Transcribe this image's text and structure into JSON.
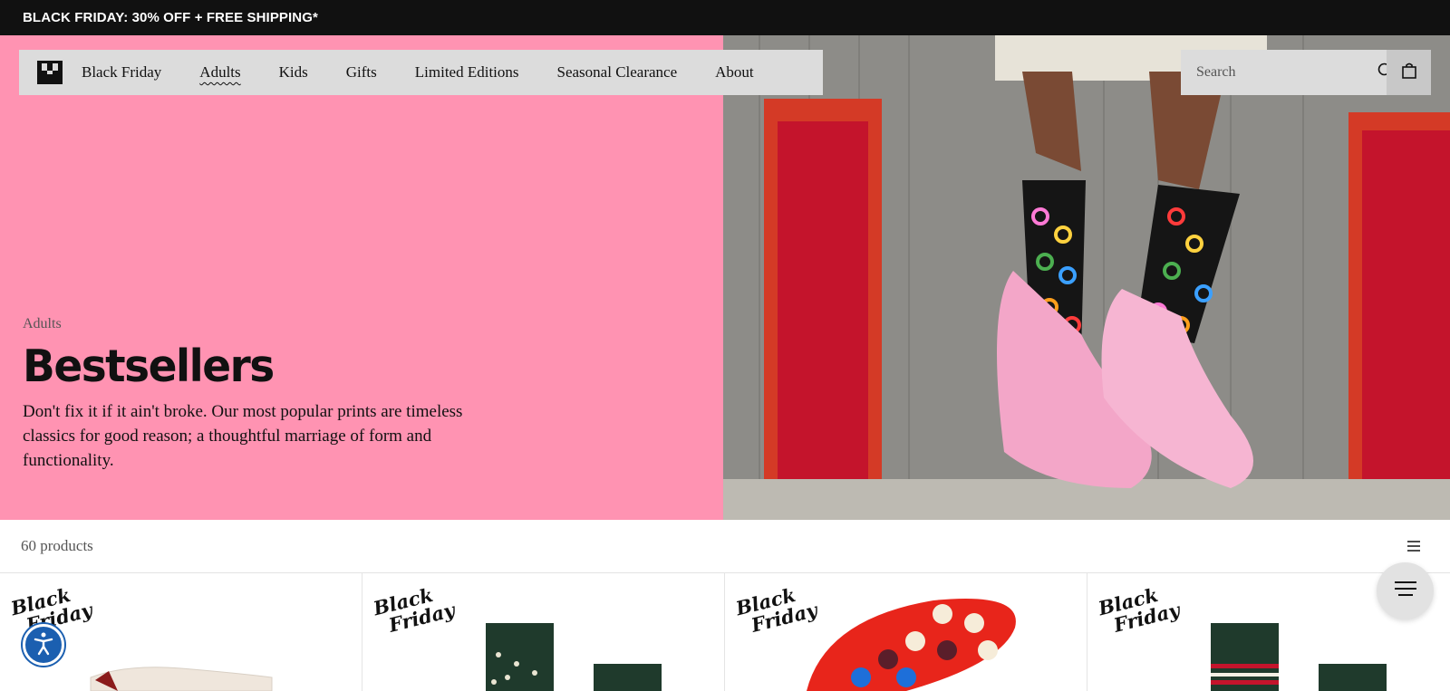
{
  "promo": {
    "text": "BLACK FRIDAY: 30% OFF + FREE SHIPPING*"
  },
  "nav": {
    "items": [
      {
        "label": "Black Friday"
      },
      {
        "label": "Adults"
      },
      {
        "label": "Kids"
      },
      {
        "label": "Gifts"
      },
      {
        "label": "Limited Editions"
      },
      {
        "label": "Seasonal Clearance"
      },
      {
        "label": "About"
      }
    ],
    "active": "Adults"
  },
  "search": {
    "placeholder": "Search"
  },
  "hero": {
    "breadcrumb": "Adults",
    "title": "Bestsellers",
    "description": "Don't fix it if it ain't broke. Our most popular prints are timeless classics for good reason; a thoughtful marriage of form and functionality."
  },
  "listing": {
    "count": "60 products"
  },
  "products": [
    {
      "badge_line1": "Black",
      "badge_line2": "Friday"
    },
    {
      "badge_line1": "Black",
      "badge_line2": "Friday"
    },
    {
      "badge_line1": "Black",
      "badge_line2": "Friday"
    },
    {
      "badge_line1": "Black",
      "badge_line2": "Friday"
    }
  ],
  "colors": {
    "promo_bg": "#111111",
    "hero_bg": "#ff93b2",
    "nav_bg": "#dcdcdc",
    "a11y_blue": "#1b5fb0"
  },
  "icons": {
    "logo": "brand-logo-icon",
    "search": "search-icon",
    "cart": "shopping-bag-icon",
    "list": "list-view-icon",
    "menu": "menu-icon",
    "accessibility": "accessibility-icon"
  }
}
